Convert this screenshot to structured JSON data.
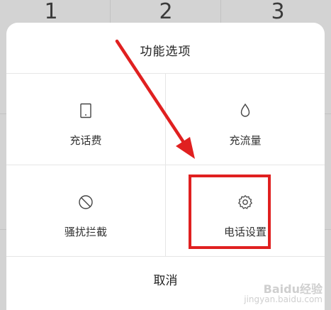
{
  "keypad": {
    "keys": [
      "1",
      "2",
      "3"
    ]
  },
  "dialog": {
    "title": "功能选项",
    "options": [
      {
        "label": "充话费",
        "icon": "phone-icon"
      },
      {
        "label": "充流量",
        "icon": "water-drop-icon"
      },
      {
        "label": "骚扰拦截",
        "icon": "block-icon"
      },
      {
        "label": "电话设置",
        "icon": "gear-icon"
      }
    ],
    "cancel_label": "取消"
  },
  "annotation": {
    "color": "#e02020",
    "highlight": "电话设置"
  },
  "watermark": {
    "brand": "Baidu经验",
    "site": "jingyan.baidu.com"
  }
}
